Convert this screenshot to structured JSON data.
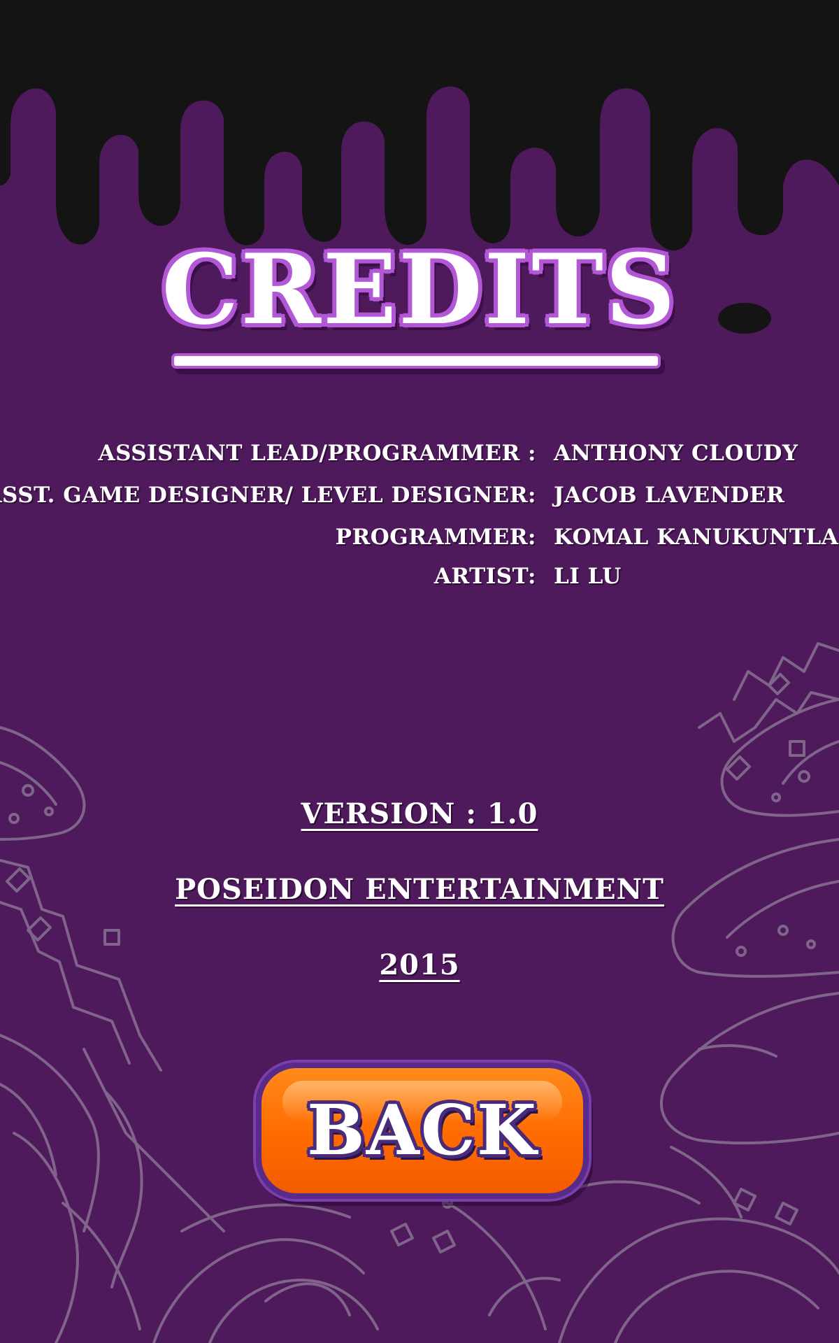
{
  "screen": {
    "title": "CREDITS",
    "credits": [
      {
        "role": "ASSISTANT LEAD/PROGRAMMER :",
        "name": "ANTHONY CLOUDY"
      },
      {
        "role": "ASST. GAME DESIGNER/ LEVEL DESIGNER:",
        "name": "JACOB LAVENDER"
      },
      {
        "role": "PROGRAMMER:",
        "name": "KOMAL KANUKUNTLA"
      },
      {
        "role": "ARTIST:",
        "name": "LI LU"
      }
    ],
    "version": "VERSION : 1.0",
    "studio": "POSEIDON ENTERTAINMENT",
    "year": "2015",
    "back_label": "BACK"
  },
  "colors": {
    "background": "#4f1a5c",
    "drip": "#141414",
    "title_outline": "#b258d6",
    "back_button": "#ff6a00",
    "back_border": "#5a2a8a"
  },
  "icons": [
    "drip-decoration",
    "line-art-mushrooms-decoration"
  ]
}
